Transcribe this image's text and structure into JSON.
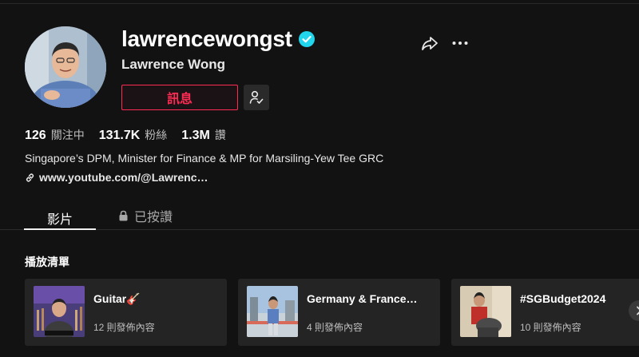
{
  "profile": {
    "username": "lawrencewongst",
    "display_name": "Lawrence Wong",
    "verified": true,
    "message_button_label": "訊息",
    "bio": "Singapore’s DPM, Minister for Finance & MP for Marsiling-Yew Tee GRC",
    "link": "www.youtube.com/@Lawrenc…"
  },
  "stats": [
    {
      "value": "126",
      "label": "關注中"
    },
    {
      "value": "131.7K",
      "label": "粉絲"
    },
    {
      "value": "1.3M",
      "label": "讚"
    }
  ],
  "tabs": [
    {
      "label": "影片",
      "active": true
    },
    {
      "label": "已按讚",
      "locked": true
    }
  ],
  "playlists": {
    "title": "播放清單",
    "items": [
      {
        "title": "Guitar🎸",
        "count": "12 則發佈內容"
      },
      {
        "title": "Germany & France…",
        "count": "4 則發佈內容"
      },
      {
        "title": "#SGBudget2024",
        "count": "10 則發佈內容"
      }
    ]
  },
  "colors": {
    "background": "#121212",
    "accent": "#fe2c55",
    "verified": "#20d5ec",
    "card": "#242424"
  },
  "icons": [
    "verified-badge-icon",
    "follow-check-icon",
    "share-icon",
    "more-icon",
    "link-icon",
    "lock-icon",
    "chevron-right-icon"
  ]
}
